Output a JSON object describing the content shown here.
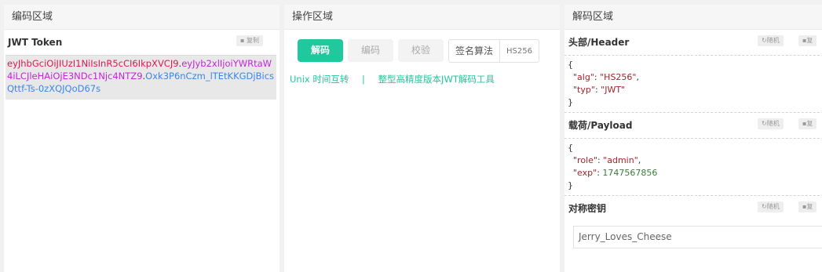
{
  "left": {
    "title": "编码区域",
    "token_label": "JWT Token",
    "copy_label": "复制",
    "token": {
      "header": "eyJhbGciOiJIUzI1NiIsInR5cCI6IkpXVCJ9",
      "payload": "eyJyb2xlIjoiYWRtaW4iLCJleHAiOjE3NDc1Njc4NTZ9",
      "signature": "Oxk3P6nCzm_lTEtKKGDjBicsQttf-Ts-0zXQJQoD67s"
    }
  },
  "middle": {
    "title": "操作区域",
    "buttons": [
      "解码",
      "编码",
      "校验"
    ],
    "alg_label": "签名算法",
    "alg_value": "HS256",
    "links": [
      "Unix 时间互转",
      "|",
      "整型高精度版本JWT解码工具"
    ]
  },
  "right": {
    "title": "解码区域",
    "header_label": "头部/Header",
    "payload_label": "载荷/Payload",
    "secret_label": "对称密钥",
    "random_label": "随机",
    "copy_label": "复",
    "header_json": {
      "alg": "HS256",
      "typ": "JWT"
    },
    "payload_json": {
      "role": "admin",
      "exp": "1747567856"
    },
    "secret_value": "Jerry_Loves_Cheese"
  }
}
